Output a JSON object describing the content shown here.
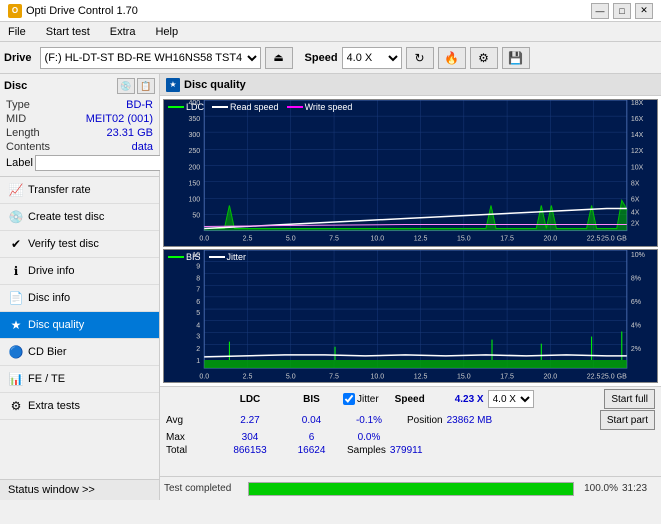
{
  "app": {
    "title": "Opti Drive Control 1.70",
    "icon": "O"
  },
  "titlebar": {
    "minimize": "—",
    "maximize": "□",
    "close": "✕"
  },
  "menu": {
    "items": [
      "File",
      "Start test",
      "Extra",
      "Help"
    ]
  },
  "drive_toolbar": {
    "drive_label": "Drive",
    "drive_value": "(F:)  HL-DT-ST BD-RE  WH16NS58 TST4",
    "speed_label": "Speed",
    "speed_value": "4.0 X"
  },
  "disc_panel": {
    "title": "Disc",
    "type_label": "Type",
    "type_value": "BD-R",
    "mid_label": "MID",
    "mid_value": "MEIT02 (001)",
    "length_label": "Length",
    "length_value": "23.31 GB",
    "contents_label": "Contents",
    "contents_value": "data",
    "label_label": "Label"
  },
  "nav_items": [
    {
      "id": "transfer-rate",
      "label": "Transfer rate",
      "icon": "📈"
    },
    {
      "id": "create-test-disc",
      "label": "Create test disc",
      "icon": "💿"
    },
    {
      "id": "verify-test-disc",
      "label": "Verify test disc",
      "icon": "✔"
    },
    {
      "id": "drive-info",
      "label": "Drive info",
      "icon": "ℹ"
    },
    {
      "id": "disc-info",
      "label": "Disc info",
      "icon": "📄"
    },
    {
      "id": "disc-quality",
      "label": "Disc quality",
      "icon": "★",
      "active": true
    },
    {
      "id": "cd-bier",
      "label": "CD Bier",
      "icon": "🔵"
    },
    {
      "id": "fe-te",
      "label": "FE / TE",
      "icon": "📊"
    },
    {
      "id": "extra-tests",
      "label": "Extra tests",
      "icon": "⚙"
    }
  ],
  "status_window": "Status window >>",
  "disc_quality": {
    "title": "Disc quality",
    "legend": {
      "ldc": "LDC",
      "read_speed": "Read speed",
      "write_speed": "Write speed"
    },
    "legend2": {
      "bis": "BIS",
      "jitter": "Jitter"
    },
    "chart1": {
      "y_ticks_left": [
        "400",
        "350",
        "300",
        "250",
        "200",
        "150",
        "100",
        "50"
      ],
      "y_ticks_right": [
        "18X",
        "16X",
        "14X",
        "12X",
        "10X",
        "8X",
        "6X",
        "4X",
        "2X"
      ],
      "x_ticks": [
        "0.0",
        "2.5",
        "5.0",
        "7.5",
        "10.0",
        "12.5",
        "15.0",
        "17.5",
        "20.0",
        "22.5",
        "25.0 GB"
      ]
    },
    "chart2": {
      "y_ticks_left": [
        "10",
        "9",
        "8",
        "7",
        "6",
        "5",
        "4",
        "3",
        "2",
        "1"
      ],
      "y_ticks_right": [
        "10%",
        "8%",
        "6%",
        "4%",
        "2%"
      ],
      "x_ticks": [
        "0.0",
        "2.5",
        "5.0",
        "7.5",
        "10.0",
        "12.5",
        "15.0",
        "17.5",
        "20.0",
        "22.5",
        "25.0 GB"
      ]
    }
  },
  "stats": {
    "headers": [
      "LDC",
      "BIS",
      "",
      "Jitter",
      "Speed",
      ""
    ],
    "avg_label": "Avg",
    "avg_ldc": "2.27",
    "avg_bis": "0.04",
    "avg_jitter": "-0.1%",
    "avg_speed": "4.23 X",
    "max_label": "Max",
    "max_ldc": "304",
    "max_bis": "6",
    "max_jitter": "0.0%",
    "pos_label": "Position",
    "pos_value": "23862 MB",
    "total_label": "Total",
    "total_ldc": "866153",
    "total_bis": "16624",
    "samples_label": "Samples",
    "samples_value": "379911",
    "start_full": "Start full",
    "start_part": "Start part",
    "speed_option": "4.0 X",
    "jitter_label": "Jitter"
  },
  "progress": {
    "percent": "100.0%",
    "time": "31:23",
    "status": "Test completed"
  }
}
